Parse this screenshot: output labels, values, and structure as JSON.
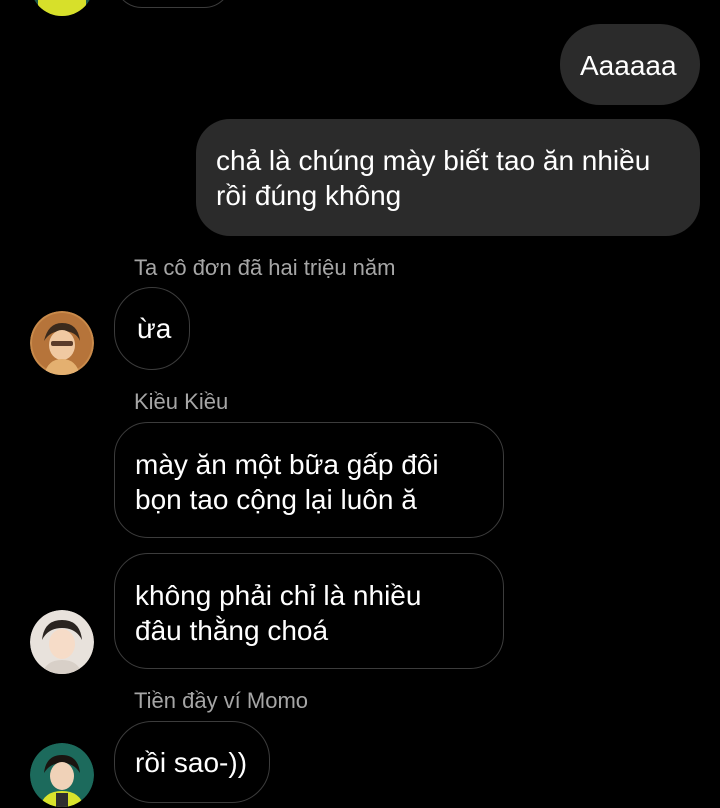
{
  "colors": {
    "background": "#000000",
    "outgoing_bubble": "#2b2b2b",
    "incoming_border": "#3c3c3c",
    "sender_name": "#a6a6a6",
    "text": "#ffffff"
  },
  "messages": [
    {
      "direction": "outgoing",
      "lines": [
        "Aaaaaa"
      ]
    },
    {
      "direction": "outgoing",
      "lines": [
        "chả là chúng mày biết tao ăn nhiều",
        "rồi đúng không"
      ]
    },
    {
      "direction": "incoming",
      "sender": "Ta cô đơn đã hai triệu năm",
      "lines": [
        "ừa"
      ],
      "avatar_icon": "user-avatar-icon"
    },
    {
      "direction": "incoming",
      "sender": "Kiều Kiều",
      "lines": [
        "mày ăn một bữa gấp đôi",
        "bọn tao cộng lại luôn ă"
      ]
    },
    {
      "direction": "incoming",
      "lines": [
        "không phải chỉ là nhiều",
        "đâu thằng choá"
      ],
      "avatar_icon": "user-avatar-icon"
    },
    {
      "direction": "incoming",
      "sender": "Tiền đầy ví Momo",
      "lines": [
        "rồi sao-))"
      ],
      "avatar_icon": "user-avatar-icon"
    }
  ]
}
